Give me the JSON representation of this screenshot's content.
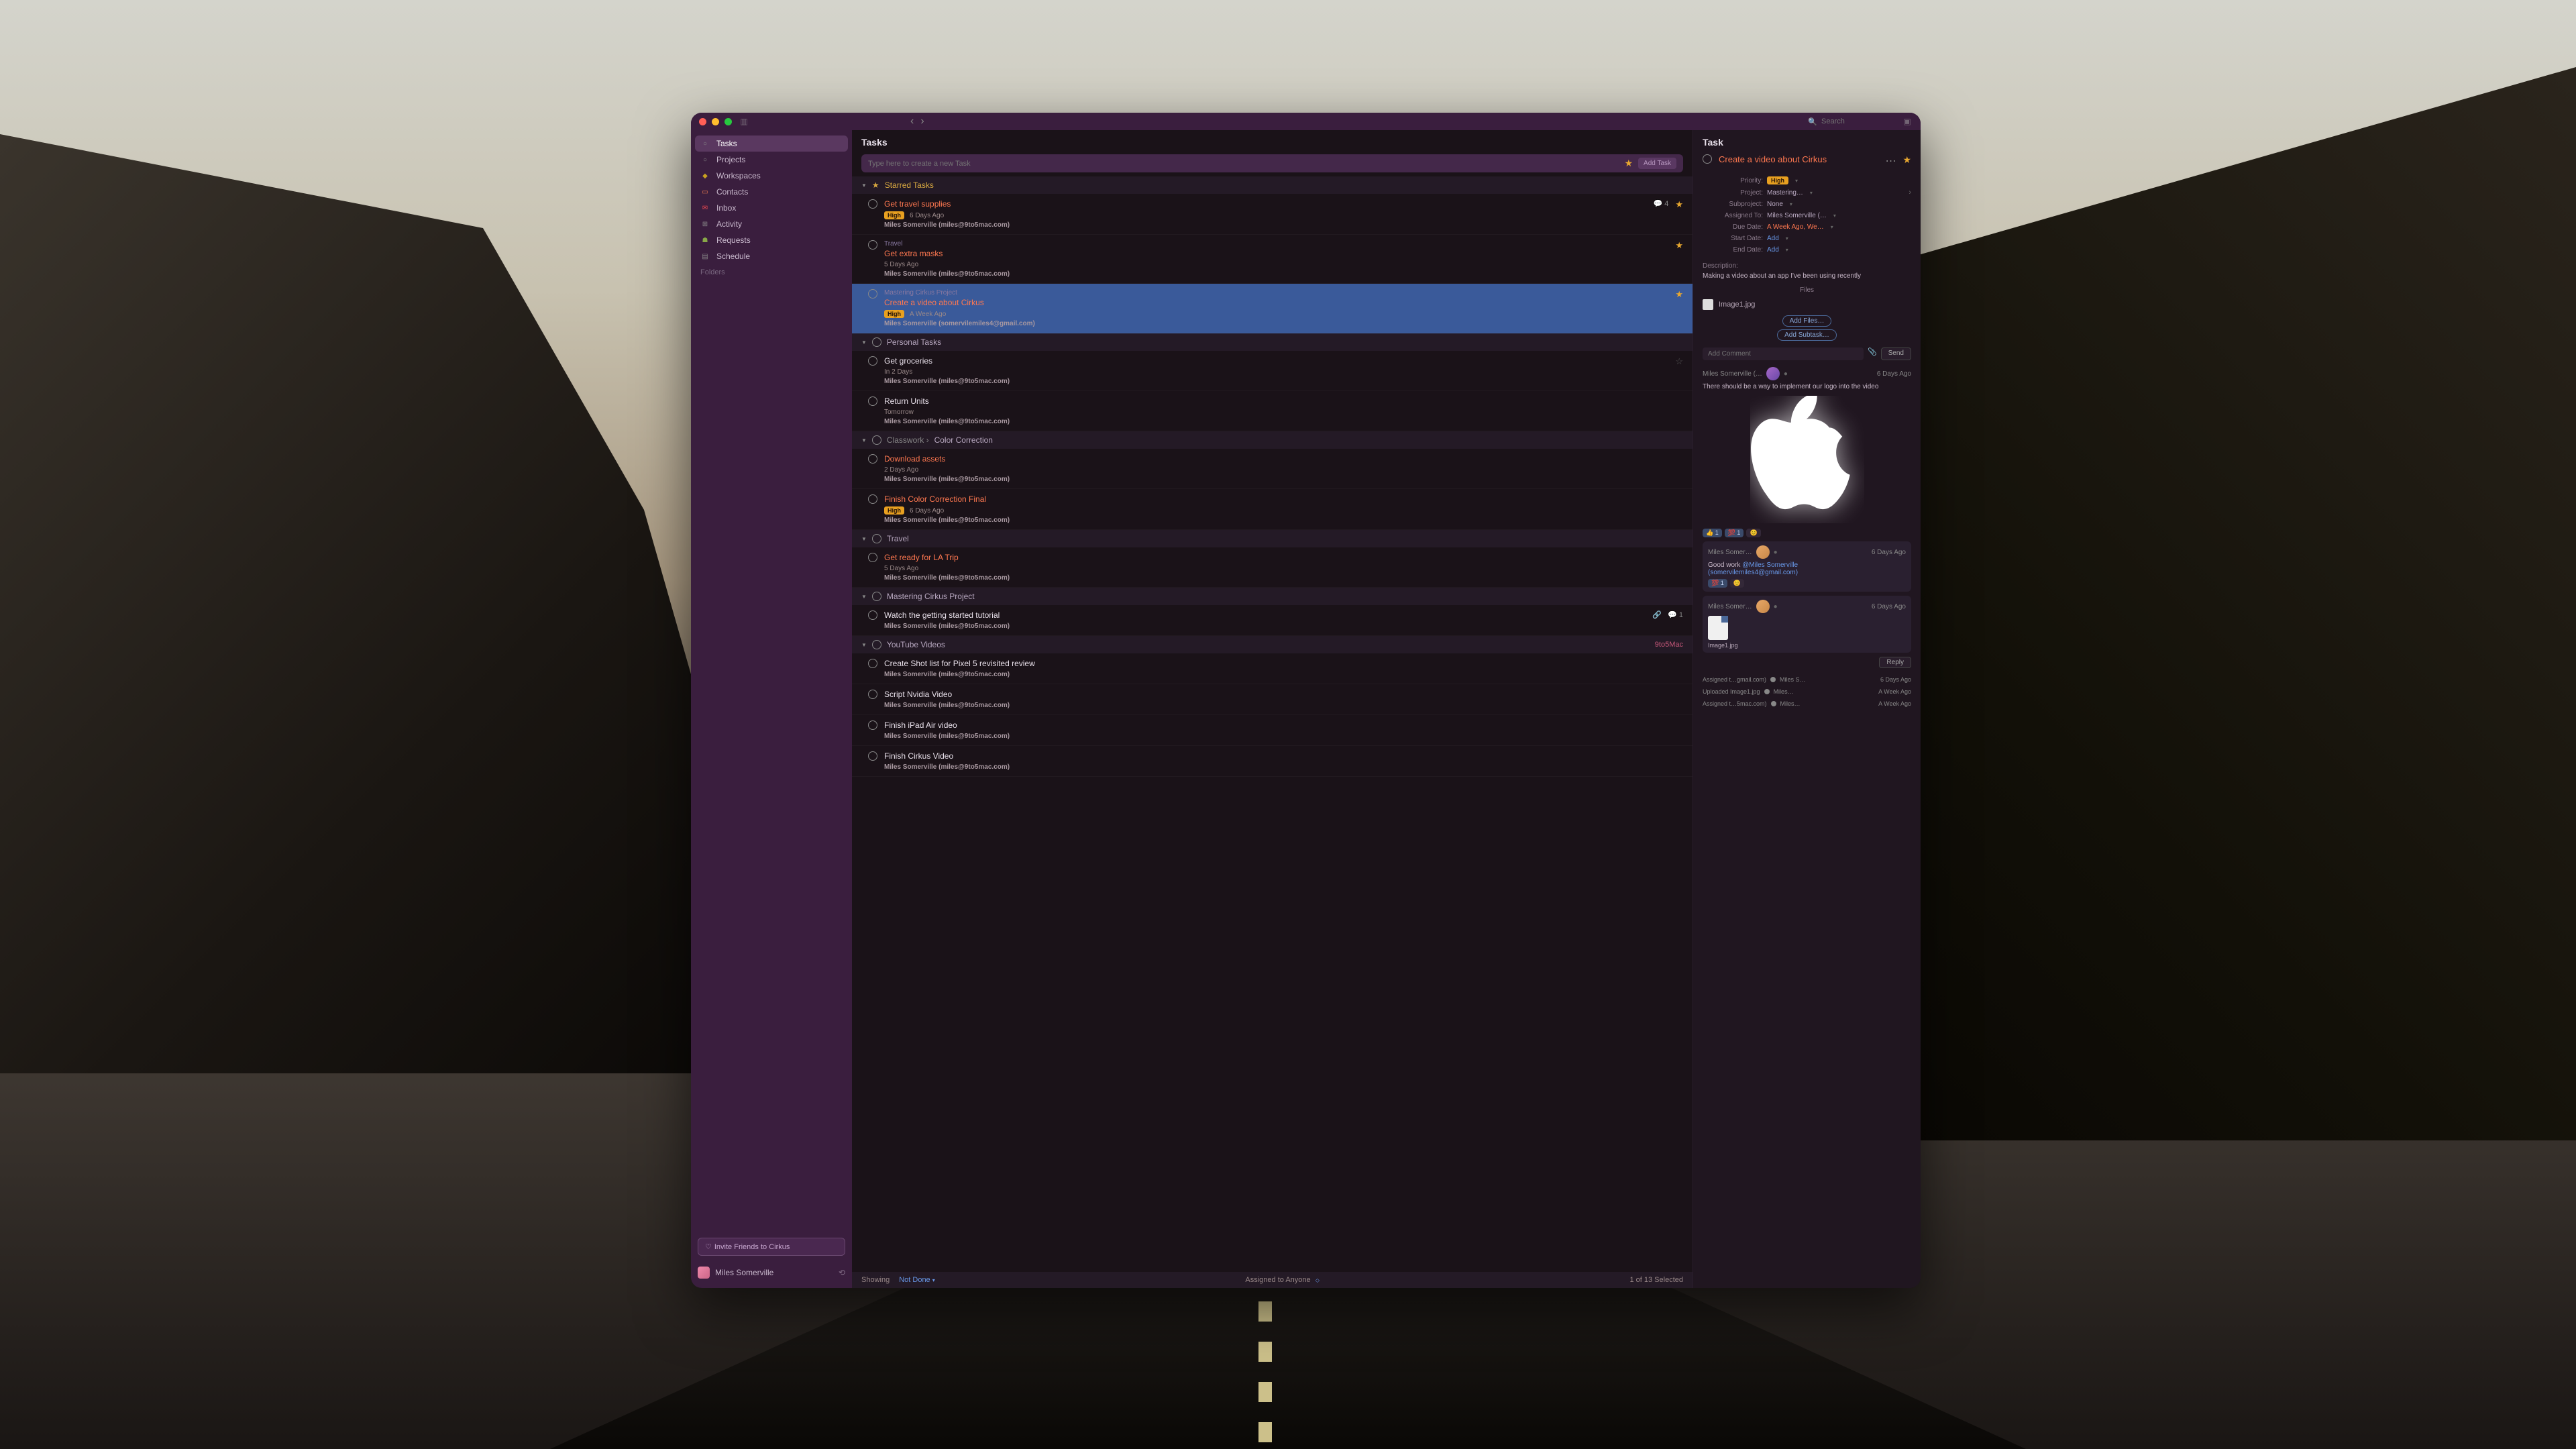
{
  "toolbar": {
    "search_placeholder": "Search"
  },
  "sidebar": {
    "items": [
      {
        "label": "Tasks",
        "icon": "○"
      },
      {
        "label": "Projects",
        "icon": "○"
      },
      {
        "label": "Workspaces",
        "icon": "◆"
      },
      {
        "label": "Contacts",
        "icon": "▭"
      },
      {
        "label": "Inbox",
        "icon": "✉"
      },
      {
        "label": "Activity",
        "icon": "⊞"
      },
      {
        "label": "Requests",
        "icon": "☗"
      },
      {
        "label": "Schedule",
        "icon": "▤"
      }
    ],
    "folders_label": "Folders",
    "invite_label": "Invite Friends to Cirkus",
    "user_name": "Miles Somerville"
  },
  "main": {
    "header": "Tasks",
    "new_task_placeholder": "Type here to create a new Task",
    "add_task_label": "Add Task",
    "sections": [
      {
        "type": "starred",
        "title": "Starred Tasks",
        "tasks": [
          {
            "title": "Get travel supplies",
            "overdue": true,
            "priority": "High",
            "due": "6 Days Ago",
            "assignee": "Miles Somerville (miles@9to5mac.com)",
            "starred": true,
            "comments": "4"
          },
          {
            "cat": "Travel",
            "title": "Get extra masks",
            "overdue": true,
            "due": "5 Days Ago",
            "assignee": "Miles Somerville (miles@9to5mac.com)",
            "starred": true
          },
          {
            "cat": "Mastering Cirkus Project",
            "title": "Create a video about Cirkus",
            "overdue": true,
            "priority": "High",
            "due": "A Week Ago",
            "assignee": "Miles Somerville (somervilemiles4@gmail.com)",
            "starred": true,
            "selected": true
          }
        ]
      },
      {
        "type": "plain",
        "title": "Personal Tasks",
        "tasks": [
          {
            "title": "Get groceries",
            "due": "In 2 Days",
            "assignee": "Miles Somerville (miles@9to5mac.com)",
            "starred": false
          },
          {
            "title": "Return Units",
            "due": "Tomorrow",
            "assignee": "Miles Somerville (miles@9to5mac.com)"
          }
        ]
      },
      {
        "type": "crumb",
        "crumb": "Classwork",
        "title": "Color Correction",
        "tasks": [
          {
            "title": "Download assets",
            "overdue": true,
            "due": "2 Days Ago",
            "assignee": "Miles Somerville (miles@9to5mac.com)"
          },
          {
            "title": "Finish Color Correction Final",
            "overdue": true,
            "priority": "High",
            "due": "6 Days Ago",
            "assignee": "Miles Somerville (miles@9to5mac.com)"
          }
        ]
      },
      {
        "type": "plain",
        "title": "Travel",
        "tasks": [
          {
            "title": "Get ready for LA Trip",
            "overdue": true,
            "due": "5 Days Ago",
            "assignee": "Miles Somerville (miles@9to5mac.com)"
          }
        ]
      },
      {
        "type": "plain",
        "title": "Mastering Cirkus Project",
        "tasks": [
          {
            "title": "Watch the getting started tutorial",
            "assignee": "Miles Somerville (miles@9to5mac.com)",
            "attach": true,
            "comments": "1"
          }
        ]
      },
      {
        "type": "plain",
        "title": "YouTube Videos",
        "tag": "9to5Mac",
        "tasks": [
          {
            "title": "Create Shot list for Pixel 5 revisited review",
            "assignee": "Miles Somerville (miles@9to5mac.com)"
          },
          {
            "title": "Script Nvidia Video",
            "assignee": "Miles Somerville (miles@9to5mac.com)"
          },
          {
            "title": "Finish iPad Air video",
            "assignee": "Miles Somerville (miles@9to5mac.com)"
          },
          {
            "title": "Finish Cirkus Video",
            "assignee": "Miles Somerville (miles@9to5mac.com)"
          }
        ]
      }
    ],
    "footer": {
      "showing_label": "Showing",
      "showing_value": "Not Done",
      "assigned_label": "Assigned to Anyone",
      "selection": "1 of 13 Selected"
    }
  },
  "detail": {
    "header": "Task",
    "title": "Create a video about Cirkus",
    "meta": {
      "priority_label": "Priority:",
      "priority_value": "High",
      "project_label": "Project:",
      "project_value": "Mastering…",
      "subproject_label": "Subproject:",
      "subproject_value": "None",
      "assigned_label": "Assigned To:",
      "assigned_value": "Miles Somerville (…",
      "due_label": "Due Date:",
      "due_value": "A Week Ago, We…",
      "start_label": "Start Date:",
      "start_value": "Add",
      "end_label": "End Date:",
      "end_value": "Add"
    },
    "description_label": "Description:",
    "description": "Making a video about an app I've been using recently",
    "files_label": "Files",
    "file_name": "Image1.jpg",
    "add_files_label": "Add Files…",
    "add_subtask_label": "Add Subtask…",
    "comment_placeholder": "Add Comment",
    "send_label": "Send",
    "comments": [
      {
        "author": "Miles Somerville (…",
        "time": "6 Days Ago",
        "body": "There should be a way to implement our logo into the video",
        "has_logo": true,
        "reactions": [
          "👍 1",
          "💯 1",
          "😊"
        ]
      }
    ],
    "replies": [
      {
        "author": "Miles Somer…",
        "time": "6 Days Ago",
        "body_prefix": "Good work ",
        "mention": "@Miles Somerville",
        "mention2": "(somervilemiles4@gmail.com)",
        "reactions": [
          "💯 1",
          "😊"
        ]
      },
      {
        "author": "Miles Somer…",
        "time": "6 Days Ago",
        "file": "Image1.jpg"
      }
    ],
    "reply_label": "Reply",
    "activity": [
      {
        "text": "Assigned t…gmail.com)",
        "who": "Miles S…",
        "time": "6 Days Ago"
      },
      {
        "text": "Uploaded Image1.jpg",
        "who": "Miles…",
        "time": "A Week Ago"
      },
      {
        "text": "Assigned t…5mac.com)",
        "who": "Miles…",
        "time": "A Week Ago"
      }
    ]
  }
}
